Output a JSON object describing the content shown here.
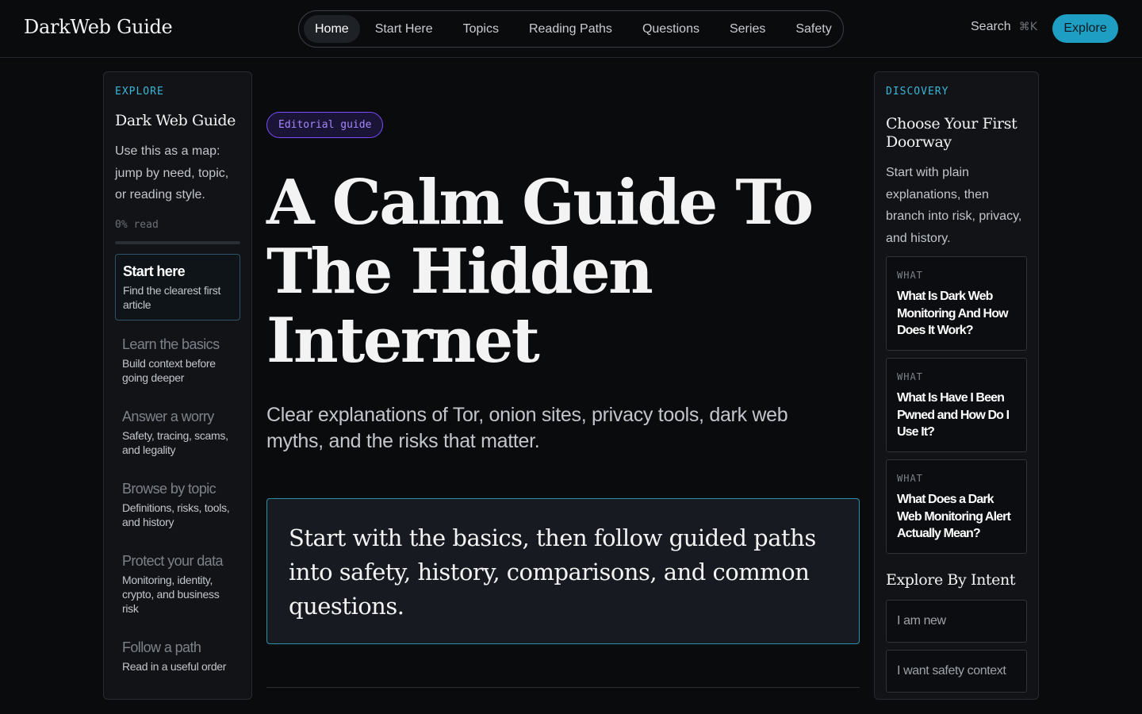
{
  "header": {
    "brand": "DarkWeb Guide",
    "nav": [
      "Home",
      "Start Here",
      "Topics",
      "Reading Paths",
      "Questions",
      "Series",
      "Safety"
    ],
    "active_nav": "Home",
    "search_label": "Search",
    "search_shortcut": "⌘K",
    "explore_label": "Explore"
  },
  "left": {
    "eyebrow": "EXPLORE",
    "title": "Dark Web Guide",
    "description": "Use this as a map: jump by need, topic, or reading style.",
    "progress_text": "0% read",
    "progress_fraction": 0,
    "items": [
      {
        "title": "Start here",
        "sub": "Find the clearest first article",
        "active": true
      },
      {
        "title": "Learn the basics",
        "sub": "Build context before going deeper",
        "active": false
      },
      {
        "title": "Answer a worry",
        "sub": "Safety, tracing, scams, and legality",
        "active": false
      },
      {
        "title": "Browse by topic",
        "sub": "Definitions, risks, tools, and history",
        "active": false
      },
      {
        "title": "Protect your data",
        "sub": "Monitoring, identity, crypto, and business risk",
        "active": false
      },
      {
        "title": "Follow a path",
        "sub": "Read in a useful order",
        "active": false
      }
    ]
  },
  "main": {
    "chip": "Editorial guide",
    "title": "A Calm Guide To The Hidden Internet",
    "subtitle": "Clear explanations of Tor, onion sites, privacy tools, dark web myths, and the risks that matter.",
    "callout": "Start with the basics, then follow guided paths into safety, history, comparisons, and common questions."
  },
  "right": {
    "eyebrow": "DISCOVERY",
    "title": "Choose Your First Doorway",
    "description": "Start with plain explanations, then branch into risk, privacy, and history.",
    "cards": [
      {
        "kicker": "WHAT",
        "title": "What Is Dark Web Monitoring And How Does It Work?"
      },
      {
        "kicker": "WHAT",
        "title": "What Is Have I Been Pwned and How Do I Use It?"
      },
      {
        "kicker": "WHAT",
        "title": "What Does a Dark Web Monitoring Alert Actually Mean?"
      }
    ],
    "intent_title": "Explore By Intent",
    "intents": [
      "I am new",
      "I want safety context"
    ]
  },
  "colors": {
    "accent": "#1f9ec4",
    "eyebrow": "#3ab6d8",
    "chip_border": "#7b4cff",
    "background": "#0a0b0d"
  }
}
